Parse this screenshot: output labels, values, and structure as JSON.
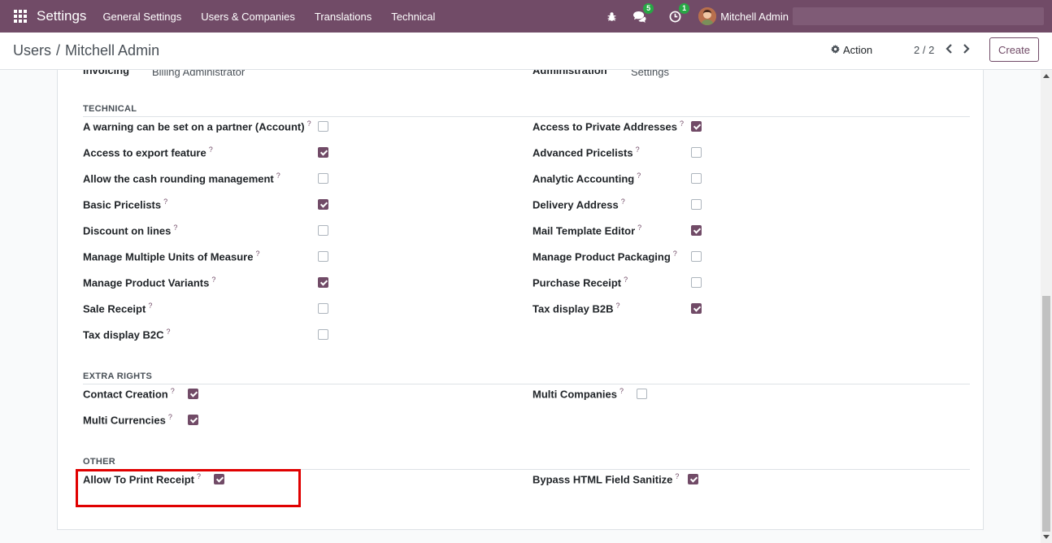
{
  "navbar": {
    "brand": "Settings",
    "menu": [
      "General Settings",
      "Users & Companies",
      "Translations",
      "Technical"
    ],
    "chat_badge": "5",
    "activity_badge": "1",
    "user_name": "Mitchell Admin"
  },
  "control_panel": {
    "breadcrumb_parent": "Users",
    "breadcrumb_separator": "/",
    "breadcrumb_current": "Mitchell Admin",
    "action_label": "Action",
    "pager": "2 / 2",
    "create_label": "Create"
  },
  "top_row": {
    "left_label": "Invoicing",
    "left_value": "Billing Administrator",
    "right_label": "Administration",
    "right_value": "Settings"
  },
  "help_mark": "?",
  "sections": {
    "technical": "TECHNICAL",
    "extra_rights": "EXTRA RIGHTS",
    "other": "OTHER"
  },
  "technical_left": [
    {
      "label": "A warning can be set on a partner (Account)",
      "checked": false
    },
    {
      "label": "Access to export feature",
      "checked": true
    },
    {
      "label": "Allow the cash rounding management",
      "checked": false
    },
    {
      "label": "Basic Pricelists",
      "checked": true
    },
    {
      "label": "Discount on lines",
      "checked": false
    },
    {
      "label": "Manage Multiple Units of Measure",
      "checked": false
    },
    {
      "label": "Manage Product Variants",
      "checked": true
    },
    {
      "label": "Sale Receipt",
      "checked": false
    },
    {
      "label": "Tax display B2C",
      "checked": false
    }
  ],
  "technical_right": [
    {
      "label": "Access to Private Addresses",
      "checked": true
    },
    {
      "label": "Advanced Pricelists",
      "checked": false
    },
    {
      "label": "Analytic Accounting",
      "checked": false
    },
    {
      "label": "Delivery Address",
      "checked": false
    },
    {
      "label": "Mail Template Editor",
      "checked": true
    },
    {
      "label": "Manage Product Packaging",
      "checked": false
    },
    {
      "label": "Purchase Receipt",
      "checked": false
    },
    {
      "label": "Tax display B2B",
      "checked": true
    }
  ],
  "extra_left": [
    {
      "label": "Contact Creation",
      "checked": true
    },
    {
      "label": "Multi Currencies",
      "checked": true
    }
  ],
  "extra_right": [
    {
      "label": "Multi Companies",
      "checked": false
    }
  ],
  "other_left": [
    {
      "label": "Allow To Print Receipt",
      "checked": true
    }
  ],
  "other_right": [
    {
      "label": "Bypass HTML Field Sanitize",
      "checked": true
    }
  ],
  "colors": {
    "brand": "#714b67",
    "highlight": "#e00000",
    "badge": "#28a745"
  }
}
